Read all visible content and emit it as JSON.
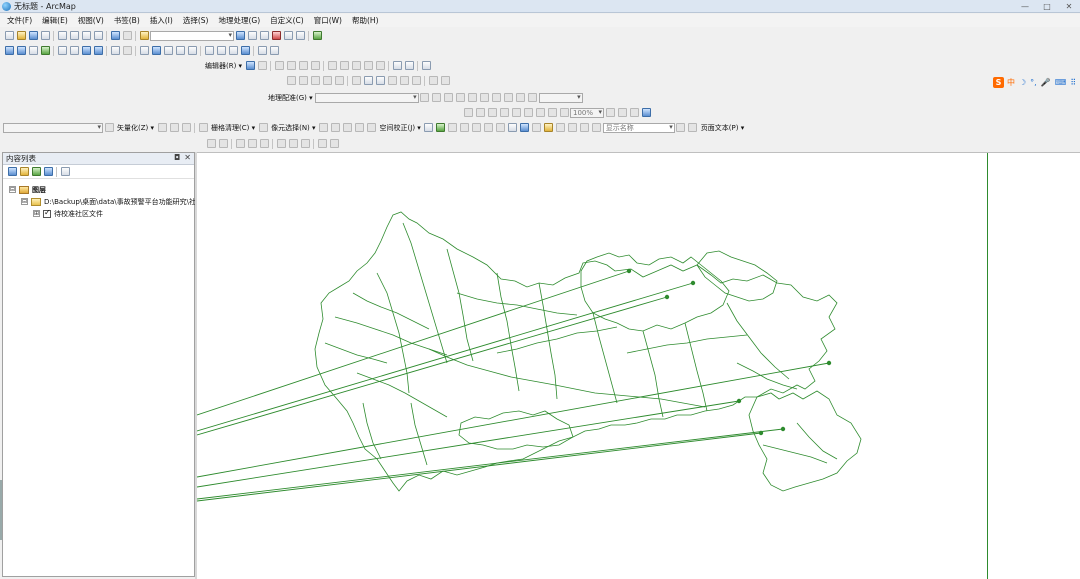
{
  "window": {
    "title": "无标题 - ArcMap",
    "controls": [
      "—",
      "□",
      "✕"
    ]
  },
  "menu": [
    "文件(F)",
    "编辑(E)",
    "视图(V)",
    "书签(B)",
    "插入(I)",
    "选择(S)",
    "地理处理(G)",
    "自定义(C)",
    "窗口(W)",
    "帮助(H)"
  ],
  "toolbars": {
    "editor_label": "编辑器(R) ▾",
    "georef_label": "地理配准(G) ▾",
    "vectorize_label": "矢量化(Z) ▾",
    "raster_clean_label": "栅格清理(C) ▾",
    "cell_select_label": "像元选择(N) ▾",
    "spatial_adjust_label": "空间校正(J) ▾",
    "zoom_value": "100%",
    "display_name_value": "显示名称",
    "page_text_label": "页面文本(P) ▾"
  },
  "sogou": {
    "logo": "S",
    "lang": "中",
    "icons": [
      "☽",
      "°,",
      "🎤",
      "⌨",
      "⠿"
    ]
  },
  "toc": {
    "title": "内容列表",
    "pin": "◘",
    "close": "✕",
    "root": {
      "expander": "⊟",
      "label": "图层"
    },
    "folder": {
      "expander": "⊟",
      "label": "D:\\Backup\\桌面\\data\\事故预警平台功能研究\\社"
    },
    "layer": {
      "expander": "⊞",
      "label": "待校准社区文件"
    }
  },
  "map": {
    "line_color": "#2e8b2e",
    "accent_color": "#2e8b2e"
  }
}
